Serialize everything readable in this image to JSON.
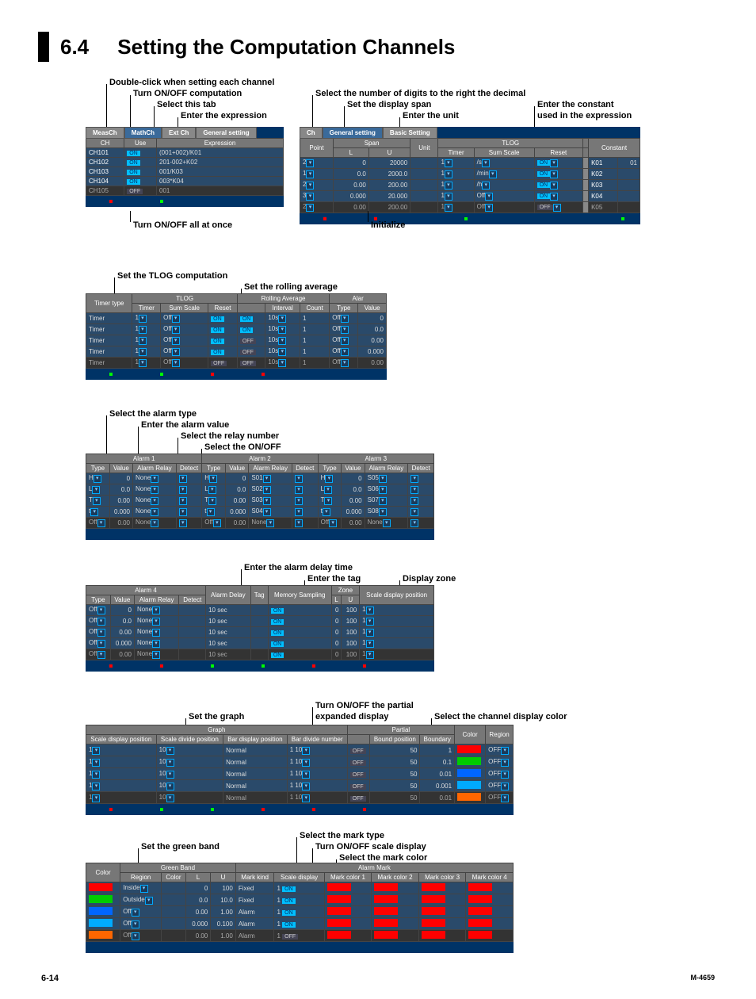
{
  "heading_number": "6.4",
  "heading_text": "Setting the Computation Channels",
  "annot_double_click": "Double-click when setting each channel",
  "annot_turn_on_off_comp": "Turn ON/OFF computation",
  "annot_select_tab": "Select this tab",
  "annot_enter_expr": "Enter the expression",
  "annot_select_digits": "Select the number of digits to the right the decimal",
  "annot_set_span": "Set the display span",
  "annot_enter_unit": "Enter the unit",
  "annot_enter_constant_1": "Enter the constant",
  "annot_enter_constant_2": "used in the expression",
  "annot_turn_on_off_all": "Turn ON/OFF all at once",
  "annot_initialize": "Initialize",
  "annot_set_tlog": "Set the TLOG computation",
  "annot_set_rolling": "Set the rolling average",
  "annot_select_alarm_type": "Select the alarm type",
  "annot_enter_alarm_value": "Enter the alarm value",
  "annot_select_relay": "Select the relay number",
  "annot_select_on_off": "Select  the ON/OFF",
  "annot_enter_alarm_delay": "Enter the alarm delay time",
  "annot_enter_tag": "Enter the tag",
  "annot_display_zone": "Display zone",
  "annot_set_graph": "Set the graph",
  "annot_turn_partial": "Turn ON/OFF the partial",
  "annot_expanded": "expanded display",
  "annot_select_color": "Select the channel display color",
  "annot_set_green_band": "Set the green band",
  "annot_select_mark_type": "Select the mark type",
  "annot_turn_scale": "Turn ON/OFF scale display",
  "annot_select_mark_color": "Select the mark color",
  "tabs": {
    "meas": "MeasCh",
    "math": "MathCh",
    "ext": "Ext Ch",
    "gen": "General setting",
    "basic": "Basic Setting"
  },
  "panel1": {
    "hdr_ch": "CH",
    "hdr_use": "Use",
    "hdr_expr": "Expression",
    "rows": [
      {
        "ch": "CH101",
        "use": "ON",
        "expr": "(001+002)/K01"
      },
      {
        "ch": "CH102",
        "use": "ON",
        "expr": "201-002+K02"
      },
      {
        "ch": "CH103",
        "use": "ON",
        "expr": "001/K03"
      },
      {
        "ch": "CH104",
        "use": "ON",
        "expr": "003*K04"
      },
      {
        "ch": "CH105",
        "use": "OFF",
        "expr": "001"
      }
    ]
  },
  "panel1b": {
    "hdr_point": "Point",
    "hdr_span": "Span",
    "hdr_L": "L",
    "hdr_U": "U",
    "hdr_unit": "Unit",
    "hdr_tlog": "TLOG",
    "hdr_timer": "Timer",
    "hdr_sumscale": "Sum Scale",
    "hdr_reset": "Reset",
    "hdr_const": "Constant",
    "rows": [
      {
        "pt": "2",
        "l": "0",
        "u": "20000",
        "t": "1",
        "ss": "/s",
        "r": "ON",
        "k": "K01",
        "kv": "01"
      },
      {
        "pt": "1",
        "l": "0.0",
        "u": "2000.0",
        "t": "1",
        "ss": "/min",
        "r": "ON",
        "k": "K02"
      },
      {
        "pt": "2",
        "l": "0.00",
        "u": "200.00",
        "t": "1",
        "ss": "/h",
        "r": "ON",
        "k": "K03"
      },
      {
        "pt": "3",
        "l": "0.000",
        "u": "20.000",
        "t": "1",
        "ss": "Off",
        "r": "ON",
        "k": "K04"
      },
      {
        "pt": "2",
        "l": "0.00",
        "u": "200.00",
        "t": "1",
        "ss": "Off",
        "r": "OFF",
        "k": "K05"
      }
    ]
  },
  "panel2": {
    "hdr_tlog": "TLOG",
    "hdr_rollavg": "Rolling Average",
    "hdr_alar": "Alar",
    "hdr_timertype": "Timer type",
    "hdr_timer": "Timer",
    "hdr_sumscale": "Sum Scale",
    "hdr_reset": "Reset",
    "hdr_interval": "Interval",
    "hdr_count": "Count",
    "hdr_type": "Type",
    "hdr_value": "Value",
    "rows": [
      {
        "tt": "Timer",
        "t": "1",
        "ss": "Off",
        "r": "ON",
        "ra": "ON",
        "iv": "10s",
        "c": "1",
        "ty": "Off",
        "v": "0"
      },
      {
        "tt": "Timer",
        "t": "1",
        "ss": "Off",
        "r": "ON",
        "ra": "ON",
        "iv": "10s",
        "c": "1",
        "ty": "Off",
        "v": "0.0"
      },
      {
        "tt": "Timer",
        "t": "1",
        "ss": "Off",
        "r": "ON",
        "ra": "OFF",
        "iv": "10s",
        "c": "1",
        "ty": "Off",
        "v": "0.00"
      },
      {
        "tt": "Timer",
        "t": "1",
        "ss": "Off",
        "r": "ON",
        "ra": "OFF",
        "iv": "10s",
        "c": "1",
        "ty": "Off",
        "v": "0.000"
      },
      {
        "tt": "Timer",
        "t": "1",
        "ss": "Off",
        "r": "OFF",
        "ra": "OFF",
        "iv": "10s",
        "c": "1",
        "ty": "Off",
        "v": "0.00"
      }
    ]
  },
  "panel3": {
    "hdr_alarm1": "Alarm 1",
    "hdr_alarm2": "Alarm 2",
    "hdr_alarm3": "Alarm 3",
    "hdr_type": "Type",
    "hdr_value": "Value",
    "hdr_relay": "Alarm Relay",
    "hdr_detect": "Detect",
    "rows": [
      {
        "t1": "H",
        "v1": "0",
        "r1": "None",
        "d1": "",
        "t2": "H",
        "v2": "0",
        "r2": "S01",
        "t3": "H",
        "v3": "0",
        "r3": "S05"
      },
      {
        "t1": "L",
        "v1": "0.0",
        "r1": "None",
        "t2": "L",
        "v2": "0.0",
        "r2": "S02",
        "t3": "L",
        "v3": "0.0",
        "r3": "S06"
      },
      {
        "t1": "T",
        "v1": "0.00",
        "r1": "None",
        "t2": "T",
        "v2": "0.00",
        "r2": "S03",
        "t3": "T",
        "v3": "0.00",
        "r3": "S07"
      },
      {
        "t1": "t",
        "v1": "0.000",
        "r1": "None",
        "t2": "t",
        "v2": "0.000",
        "r2": "S04",
        "t3": "t",
        "v3": "0.000",
        "r3": "S08"
      },
      {
        "t1": "Off",
        "v1": "0.00",
        "r1": "None",
        "t2": "Off",
        "v2": "0.00",
        "r2": "None",
        "t3": "Off",
        "v3": "0.00",
        "r3": "None"
      }
    ]
  },
  "panel4": {
    "hdr_alarm4": "Alarm 4",
    "hdr_alarmdelay": "Alarm Delay",
    "hdr_tag": "Tag",
    "hdr_memsamp": "Memory Sampling",
    "hdr_zone": "Zone",
    "hdr_L": "L",
    "hdr_U": "U",
    "hdr_sdp": "Scale display position",
    "hdr_type": "Type",
    "hdr_value": "Value",
    "hdr_relay": "Alarm Relay",
    "hdr_detect": "Detect",
    "rows": [
      {
        "t": "Off",
        "v": "0",
        "r": "None",
        "ad": "10 sec",
        "ms": "ON",
        "l": "0",
        "u": "100",
        "sdp": "1"
      },
      {
        "t": "Off",
        "v": "0.0",
        "r": "None",
        "ad": "10 sec",
        "ms": "ON",
        "l": "0",
        "u": "100",
        "sdp": "1"
      },
      {
        "t": "Off",
        "v": "0.00",
        "r": "None",
        "ad": "10 sec",
        "ms": "ON",
        "l": "0",
        "u": "100",
        "sdp": "1"
      },
      {
        "t": "Off",
        "v": "0.000",
        "r": "None",
        "ad": "10 sec",
        "ms": "ON",
        "l": "0",
        "u": "100",
        "sdp": "1"
      },
      {
        "t": "Off",
        "v": "0.00",
        "r": "None",
        "ad": "10 sec",
        "ms": "ON",
        "l": "0",
        "u": "100",
        "sdp": "1"
      }
    ]
  },
  "panel5": {
    "hdr_graph": "Graph",
    "hdr_partial": "Partial",
    "hdr_color": "Color",
    "hdr_sdp": "Scale display position",
    "hdr_sdivp": "Scale divide position",
    "hdr_bdp": "Bar display position",
    "hdr_bdn": "Bar divide number",
    "hdr_bound": "Bound position",
    "hdr_boundary": "Boundary",
    "hdr_region": "Region",
    "rows": [
      {
        "sdp": "1",
        "sdivp": "10",
        "bdp": "Normal",
        "bdn": "1",
        "bd2": "10",
        "p": "OFF",
        "bp": "50",
        "by": "1",
        "c": "red",
        "r": "OFF"
      },
      {
        "sdp": "1",
        "sdivp": "10",
        "bdp": "Normal",
        "bdn": "1",
        "bd2": "10",
        "p": "OFF",
        "bp": "50",
        "by": "0.1",
        "c": "green",
        "r": "OFF"
      },
      {
        "sdp": "1",
        "sdivp": "10",
        "bdp": "Normal",
        "bdn": "1",
        "bd2": "10",
        "p": "OFF",
        "bp": "50",
        "by": "0.01",
        "c": "blue",
        "r": "OFF"
      },
      {
        "sdp": "1",
        "sdivp": "10",
        "bdp": "Normal",
        "bdn": "1",
        "bd2": "10",
        "p": "OFF",
        "bp": "50",
        "by": "0.001",
        "c": "blueish",
        "r": "OFF"
      },
      {
        "sdp": "1",
        "sdivp": "10",
        "bdp": "Normal",
        "bdn": "1",
        "bd2": "10",
        "p": "OFF",
        "bp": "50",
        "by": "0.01",
        "c": "orange",
        "r": "OFF"
      }
    ]
  },
  "panel6": {
    "hdr_color": "Color",
    "hdr_green": "Green Band",
    "hdr_alarmark": "Alarm Mark",
    "hdr_region": "Region",
    "hdr_gcolor": "Color",
    "hdr_L": "L",
    "hdr_U": "U",
    "hdr_markkind": "Mark kind",
    "hdr_scaledisp": "Scale display",
    "hdr_mc1": "Mark color 1",
    "hdr_mc2": "Mark color 2",
    "hdr_mc3": "Mark color 3",
    "hdr_mc4": "Mark color 4",
    "rows": [
      {
        "reg": "Inside",
        "c": "red",
        "l": "0",
        "u": "100",
        "mk": "Fixed",
        "md": "1",
        "sd": "ON"
      },
      {
        "reg": "Outside",
        "c": "green",
        "l": "0.0",
        "u": "10.0",
        "mk": "Fixed",
        "md": "1",
        "sd": "ON"
      },
      {
        "reg": "Off",
        "c": "blue",
        "l": "0.00",
        "u": "1.00",
        "mk": "Alarm",
        "md": "1",
        "sd": "ON"
      },
      {
        "reg": "Off",
        "c": "blueish",
        "l": "0.000",
        "u": "0.100",
        "mk": "Alarm",
        "md": "1",
        "sd": "ON"
      },
      {
        "reg": "Off",
        "c": "orange",
        "l": "0.00",
        "u": "1.00",
        "mk": "Alarm",
        "md": "1",
        "sd": "OFF"
      }
    ]
  },
  "footer_left": "6-14",
  "footer_right": "M-4659"
}
